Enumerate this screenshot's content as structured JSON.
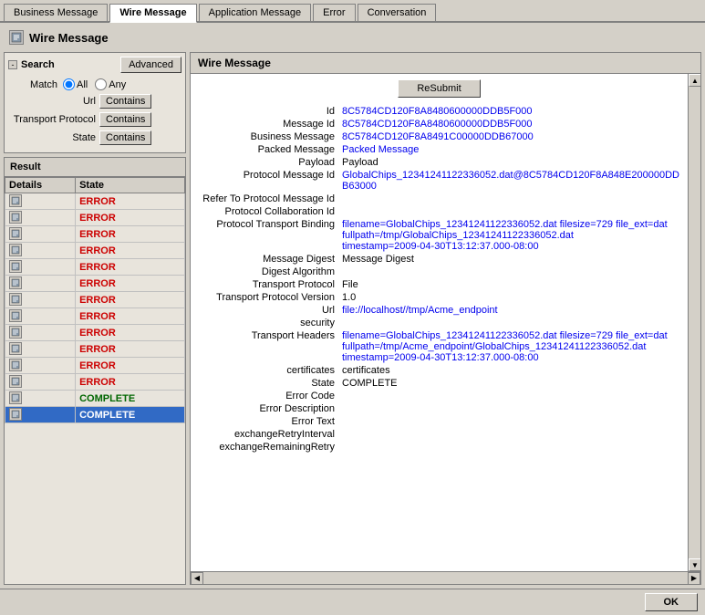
{
  "tabs": [
    {
      "label": "Business Message",
      "active": false
    },
    {
      "label": "Wire Message",
      "active": true
    },
    {
      "label": "Application Message",
      "active": false
    },
    {
      "label": "Error",
      "active": false
    },
    {
      "label": "Conversation",
      "active": false
    }
  ],
  "page": {
    "title": "Wire Message"
  },
  "search": {
    "title": "Search",
    "advanced_label": "Advanced",
    "match_label": "Match",
    "all_label": "All",
    "any_label": "Any",
    "url_label": "Url",
    "contains_url": "Contains",
    "transport_label": "Transport Protocol",
    "contains_transport": "Contains",
    "state_label": "State",
    "contains_state": "Contains"
  },
  "result": {
    "title": "Result",
    "col_details": "Details",
    "col_state": "State",
    "rows": [
      {
        "state": "ERROR",
        "selected": false
      },
      {
        "state": "ERROR",
        "selected": false
      },
      {
        "state": "ERROR",
        "selected": false
      },
      {
        "state": "ERROR",
        "selected": false
      },
      {
        "state": "ERROR",
        "selected": false
      },
      {
        "state": "ERROR",
        "selected": false
      },
      {
        "state": "ERROR",
        "selected": false
      },
      {
        "state": "ERROR",
        "selected": false
      },
      {
        "state": "ERROR",
        "selected": false
      },
      {
        "state": "ERROR",
        "selected": false
      },
      {
        "state": "ERROR",
        "selected": false
      },
      {
        "state": "ERROR",
        "selected": false
      },
      {
        "state": "COMPLETE",
        "selected": false
      },
      {
        "state": "COMPLETE",
        "selected": true
      }
    ]
  },
  "detail": {
    "title": "Wire Message",
    "resubmit_label": "ReSubmit",
    "fields": [
      {
        "key": "Id",
        "value": "8C5784CD120F8A8480600000DDB5F000",
        "color": "blue"
      },
      {
        "key": "Message Id",
        "value": "8C5784CD120F8A8480600000DDB5F000",
        "color": "blue"
      },
      {
        "key": "Business Message",
        "value": "8C5784CD120F8A8491C00000DDB67000",
        "color": "blue"
      },
      {
        "key": "Packed Message",
        "value": "Packed Message",
        "color": "blue"
      },
      {
        "key": "Payload",
        "value": "Payload",
        "color": "black"
      },
      {
        "key": "Protocol Message Id",
        "value": "GlobalChips_12341241122336052.dat@8C5784CD120F8A848E200000DDB63000",
        "color": "blue"
      },
      {
        "key": "Refer To Protocol Message Id",
        "value": "",
        "color": "black"
      },
      {
        "key": "Protocol Collaboration Id",
        "value": "",
        "color": "black"
      },
      {
        "key": "Protocol Transport Binding",
        "value": "filename=GlobalChips_12341241122336052.dat filesize=729 file_ext=dat\nfullpath=/tmp/GlobalChips_12341241122336052.dat\ntimestamp=2009-04-30T13:12:37.000-08:00",
        "color": "blue"
      },
      {
        "key": "Message Digest",
        "value": "Message Digest",
        "color": "black"
      },
      {
        "key": "Digest Algorithm",
        "value": "",
        "color": "black"
      },
      {
        "key": "Transport Protocol",
        "value": "File",
        "color": "black"
      },
      {
        "key": "Transport Protocol Version",
        "value": "1.0",
        "color": "black"
      },
      {
        "key": "Url",
        "value": "file://localhost//tmp/Acme_endpoint",
        "color": "blue"
      },
      {
        "key": "security",
        "value": "",
        "color": "black"
      },
      {
        "key": "Transport Headers",
        "value": "filename=GlobalChips_12341241122336052.dat filesize=729 file_ext=dat\nfullpath=/tmp/Acme_endpoint/GlobalChips_12341241122336052.dat\ntimestamp=2009-04-30T13:12:37.000-08:00",
        "color": "blue"
      },
      {
        "key": "certificates",
        "value": "certificates",
        "color": "black"
      },
      {
        "key": "State",
        "value": "COMPLETE",
        "color": "black"
      },
      {
        "key": "Error Code",
        "value": "",
        "color": "black"
      },
      {
        "key": "Error Description",
        "value": "",
        "color": "black"
      },
      {
        "key": "Error Text",
        "value": "",
        "color": "black"
      },
      {
        "key": "exchangeRetryInterval",
        "value": "",
        "color": "black"
      },
      {
        "key": "exchangeRemainingRetry",
        "value": "",
        "color": "black"
      }
    ]
  },
  "bottom": {
    "ok_label": "OK"
  }
}
